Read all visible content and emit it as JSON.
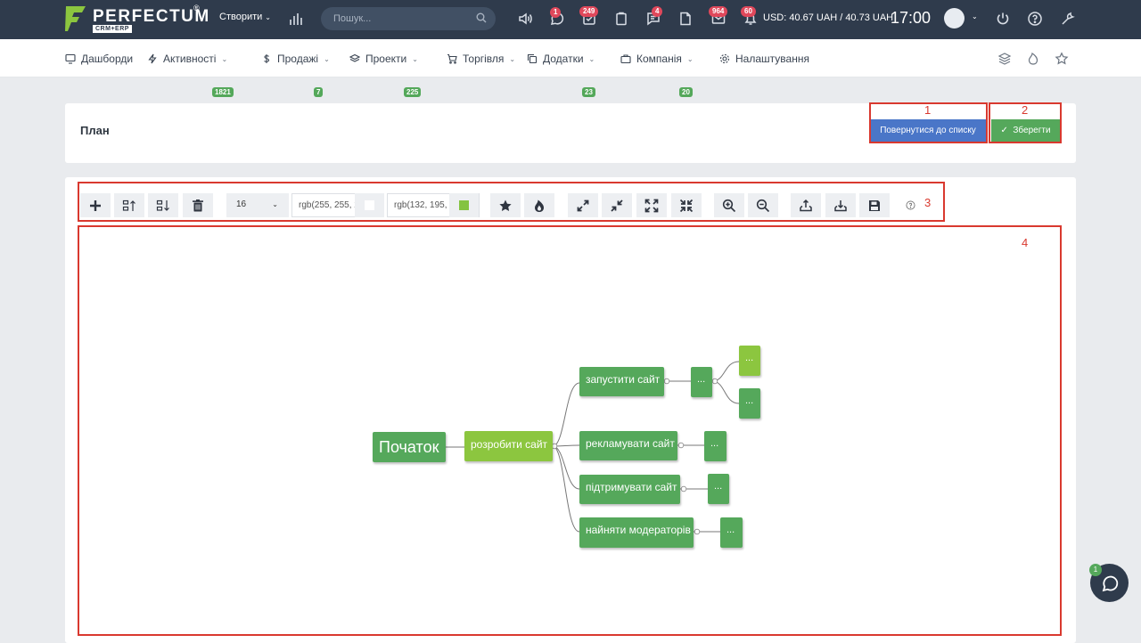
{
  "topbar": {
    "logo_text": "PERFECTUM",
    "logo_sub": "CRM+ERP",
    "logo_reg": "®",
    "create_label": "Створити",
    "search_placeholder": "Пошук...",
    "badges": {
      "chat": "1",
      "tasks": "249",
      "messages": "4",
      "mail": "964",
      "notifications": "60"
    },
    "currency": "USD: 40.67 UAH / 40.73 UAH",
    "time": "17:00"
  },
  "nav": {
    "items": [
      {
        "label": "Дашборди",
        "icon": "monitor-icon"
      },
      {
        "label": "Активності",
        "icon": "bolt-icon",
        "badge": "1821"
      },
      {
        "label": "Продажі",
        "icon": "dollar-icon",
        "badge": "7"
      },
      {
        "label": "Проекти",
        "icon": "layers-icon",
        "badge": "225"
      },
      {
        "label": "Торгівля",
        "icon": "cart-icon"
      },
      {
        "label": "Додатки",
        "icon": "copy-icon",
        "badge": "23"
      },
      {
        "label": "Компанія",
        "icon": "briefcase-icon",
        "badge": "20"
      },
      {
        "label": "Налаштування",
        "icon": "gear-icon"
      }
    ]
  },
  "page": {
    "title": "План",
    "back_button": "Повернутися до списку",
    "save_button": "Зберегти",
    "save_check": "✓"
  },
  "toolbar": {
    "font_size": "16",
    "text_color": "rgb(255, 255, 255)",
    "text_color_hex": "#ffffff",
    "bg_color": "rgb(132, 195, 65)",
    "bg_color_hex": "#84c341"
  },
  "annotations": [
    "1",
    "2",
    "3",
    "4"
  ],
  "mindmap": {
    "root": "Початок",
    "main": "розробити сайт",
    "branches": [
      "запустити сайт",
      "рекламувати сайт",
      "підтримувати сайт",
      "найняти модераторів"
    ],
    "leaf": "..."
  },
  "chat": {
    "badge": "1"
  },
  "colors": {
    "topbar": "#2f3b4c",
    "accent_blue": "#4a76c8",
    "accent_green": "#55a85b",
    "lime": "#8cc63f",
    "badge_red": "#e0485b",
    "annotation_red": "#d9392f"
  }
}
